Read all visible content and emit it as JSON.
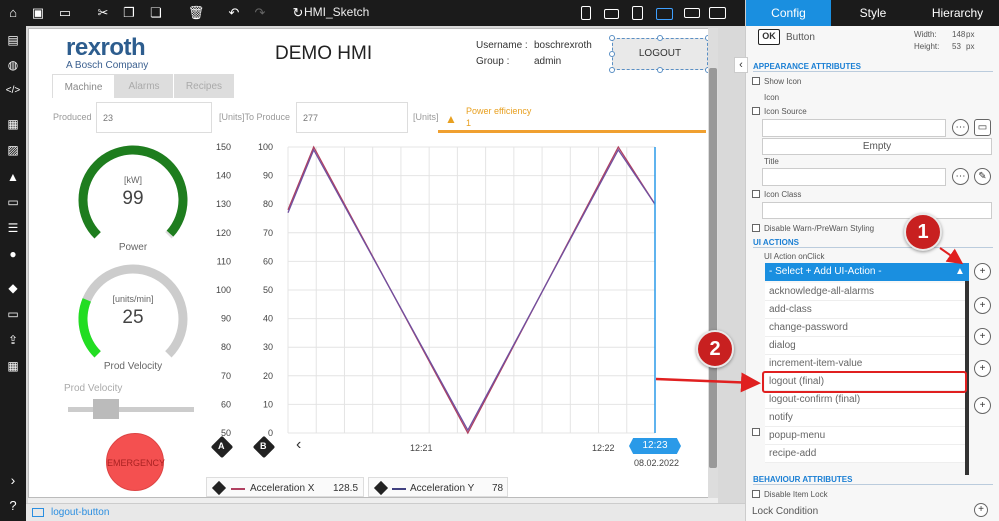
{
  "toolbar": {
    "home_icon": "home-icon",
    "sketch_name": "HMI_Sketch",
    "icons": [
      "save-icon",
      "monitor-icon",
      "cut-icon",
      "copy-icon",
      "paste-icon",
      "trash-icon",
      "undo-icon",
      "redo-icon",
      "refresh-icon"
    ]
  },
  "canvas": {
    "logo_main": "rexroth",
    "logo_sub": "A Bosch Company",
    "title": "DEMO HMI",
    "username_label": "Username :",
    "username_value": "boschrexroth",
    "group_label": "Group :",
    "group_value": "admin",
    "logout_label": "LOGOUT",
    "tabs": [
      "Machine",
      "Alarms",
      "Recipes"
    ],
    "produced_label": "Produced",
    "produced_value": "23",
    "to_produce_label": "[Units]To Produce",
    "to_produce_value": "277",
    "units_label": "[Units]",
    "power_eff_label": "Power efficiency",
    "power_eff_value": "1",
    "gauge1": {
      "unit": "[kW]",
      "value": "99",
      "label": "Power",
      "level": 0.99,
      "color": "#1e7d1e"
    },
    "gauge2": {
      "unit": "[units/min]",
      "value": "25",
      "label": "Prod Velocity",
      "level": 0.25,
      "color": "#22dd22"
    },
    "slider_label": "Prod Velocity",
    "slider_level": 0.25,
    "emergency_label": "EMERGENCY",
    "chart_time_labels": [
      "12:21",
      "12:22"
    ],
    "current_time": "12:23",
    "current_date": "08.02.2022",
    "legend": [
      {
        "axis": "A",
        "name": "Acceleration X",
        "value": "128.5",
        "color": "#b04060"
      },
      {
        "axis": "B",
        "name": "Acceleration Y",
        "value": "78",
        "color": "#404080"
      }
    ]
  },
  "chart_data": {
    "type": "line",
    "axes": [
      {
        "id": "A",
        "ticks": [
          "150",
          "140",
          "130",
          "120",
          "110",
          "100",
          "90",
          "80",
          "70",
          "60",
          "50"
        ],
        "ylim": [
          50,
          150
        ]
      },
      {
        "id": "B",
        "ticks": [
          "100",
          "90",
          "80",
          "70",
          "60",
          "50",
          "40",
          "30",
          "20",
          "10",
          "0"
        ],
        "ylim": [
          0,
          100
        ]
      }
    ],
    "series": [
      {
        "name": "Acceleration X",
        "axis": "A",
        "color": "#b04060",
        "x": [
          0,
          0.07,
          0.49,
          0.9,
          1.0
        ],
        "y": [
          128,
          150,
          50,
          150,
          130
        ]
      },
      {
        "name": "Acceleration Y",
        "axis": "B",
        "color": "#7050a0",
        "x": [
          0,
          0.07,
          0.49,
          0.9,
          1.0
        ],
        "y": [
          77,
          99,
          1,
          99,
          80
        ]
      }
    ]
  },
  "status": {
    "selected_element": "logout-button"
  },
  "panel": {
    "tabs": [
      "Config",
      "Style",
      "Hierarchy"
    ],
    "element_badge": "OK",
    "element_type": "Button",
    "width_label": "Width:",
    "width_value": "148",
    "height_label": "Height:",
    "height_value": "53",
    "unit": "px",
    "sections": {
      "appearance": "APPEARANCE ATTRIBUTES",
      "ui_actions": "UI ACTIONS",
      "behaviour": "BEHAVIOUR ATTRIBUTES"
    },
    "show_icon": "Show Icon",
    "icon_label": "Icon",
    "icon_source_label": "Icon Source",
    "empty_label": "Empty",
    "title_label": "Title",
    "icon_class_label": "Icon Class",
    "disable_warn": "Disable Warn-/PreWarn Styling",
    "action_label": "UI Action onClick",
    "select_action": "- Select + Add UI-Action -",
    "dropdown_options": [
      "acknowledge-all-alarms",
      "add-class",
      "change-password",
      "dialog",
      "increment-item-value",
      "logout (final)",
      "logout-confirm (final)",
      "notify",
      "popup-menu",
      "recipe-add"
    ],
    "disable_lock": "Disable Item Lock",
    "lock_condition": "Lock Condition",
    "annotations": [
      "1",
      "2"
    ],
    "accent_color": "#1a8fe0",
    "highlight_color": "#e02020"
  }
}
